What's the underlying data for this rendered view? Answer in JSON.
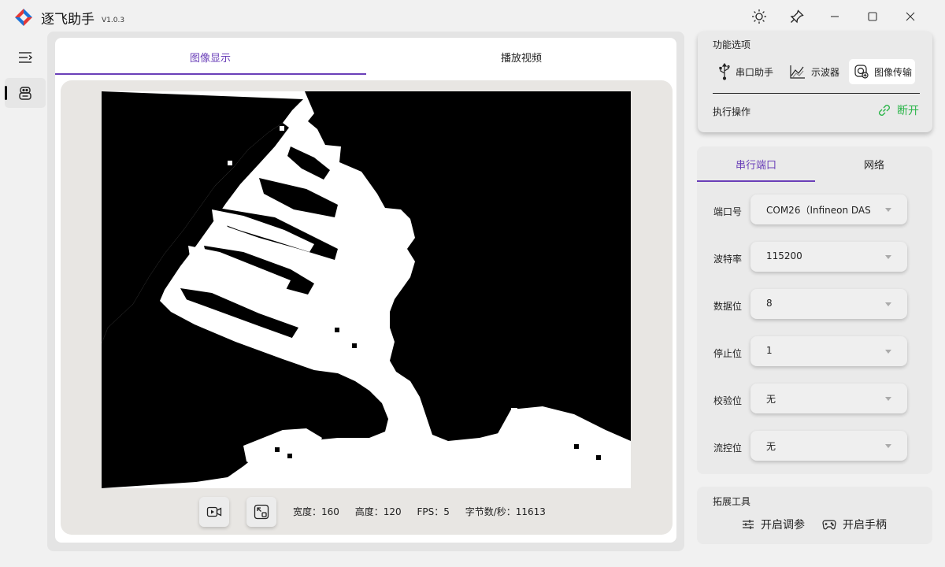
{
  "app": {
    "title": "逐飞助手",
    "version": "V1.0.3",
    "brand_colors": [
      "#e53935",
      "#1e73d8"
    ]
  },
  "titlebar": {
    "icons": [
      "sun-icon",
      "pin-icon",
      "minimize-icon",
      "maximize-icon",
      "close-icon"
    ]
  },
  "nav": {
    "items": [
      {
        "icon": "menu-toggle-icon",
        "active": false
      },
      {
        "icon": "robot-icon",
        "active": true
      }
    ]
  },
  "main": {
    "tabs": [
      {
        "label": "图像显示",
        "active": true
      },
      {
        "label": "播放视频",
        "active": false
      }
    ],
    "accent": "#6a3fb8",
    "stats": {
      "width": "宽度：160",
      "height": "高度：120",
      "fps": "FPS：5",
      "bytes": "字节数/秒：11613"
    },
    "controls": [
      "record-video-icon",
      "fullscreen-icon"
    ]
  },
  "functions": {
    "title": "功能选项",
    "buttons": [
      {
        "label": "串口助手",
        "icon": "usb-icon",
        "active": false
      },
      {
        "label": "示波器",
        "icon": "oscilloscope-icon",
        "active": false
      },
      {
        "label": "图像传输",
        "icon": "image-transfer-icon",
        "active": true
      }
    ],
    "action_label": "执行操作",
    "disconnect_label": "断开",
    "disconnect_color": "#2bb54a"
  },
  "serial": {
    "tabs": [
      {
        "label": "串行端口",
        "active": true
      },
      {
        "label": "网络",
        "active": false
      }
    ],
    "fields": [
      {
        "label": "端口号",
        "value": "COM26（Infineon DAS"
      },
      {
        "label": "波特率",
        "value": "115200"
      },
      {
        "label": "数据位",
        "value": "8"
      },
      {
        "label": "停止位",
        "value": "1"
      },
      {
        "label": "校验位",
        "value": "无"
      },
      {
        "label": "流控位",
        "value": "无"
      }
    ]
  },
  "extensions": {
    "title": "拓展工具",
    "buttons": [
      {
        "label": "开启调参",
        "icon": "sliders-icon"
      },
      {
        "label": "开启手柄",
        "icon": "gamepad-icon"
      }
    ]
  }
}
